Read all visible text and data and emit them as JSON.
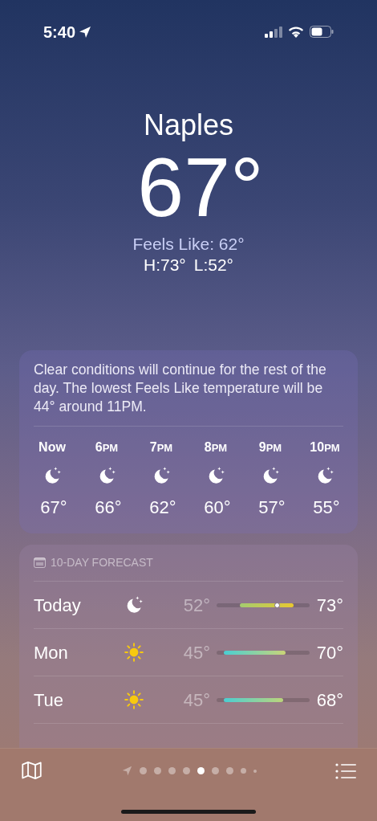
{
  "status_bar": {
    "time": "5:40",
    "location_on": true
  },
  "location": {
    "city": "Naples",
    "temperature": "67°",
    "feels_like": "Feels Like: 62°",
    "high": "H:73°",
    "low": "L:52°"
  },
  "hourly": {
    "summary": "Clear conditions will continue for the rest of the day. The lowest Feels Like temperature will be 44° around 11PM.",
    "hours": [
      {
        "hour": "Now",
        "kind": "moon",
        "temp": "67°"
      },
      {
        "hour": "6",
        "suffix": "PM",
        "kind": "moon",
        "temp": "66°"
      },
      {
        "hour": "7",
        "suffix": "PM",
        "kind": "moon",
        "temp": "62°"
      },
      {
        "hour": "8",
        "suffix": "PM",
        "kind": "moon",
        "temp": "60°"
      },
      {
        "hour": "9",
        "suffix": "PM",
        "kind": "moon",
        "temp": "57°"
      },
      {
        "hour": "10",
        "suffix": "PM",
        "kind": "moon",
        "temp": "55°"
      }
    ]
  },
  "forecast": {
    "title": "10-DAY FORECAST",
    "days": [
      {
        "day": "Today",
        "kind": "moon",
        "low": "52°",
        "high": "73°",
        "start": {
          "level": 0.27,
          "color": "#a6cc6e"
        },
        "end": {
          "level": 0.81,
          "color": "#e6c832"
        },
        "current": {
          "level": 0.65
        }
      },
      {
        "day": "Mon",
        "kind": "sun",
        "low": "45°",
        "high": "70°",
        "start": {
          "level": 0.1,
          "color": "#4fcfcf"
        },
        "end": {
          "level": 0.72,
          "color": "#c6d47a"
        }
      },
      {
        "day": "Tue",
        "kind": "sun",
        "low": "45°",
        "high": "68°",
        "start": {
          "level": 0.1,
          "color": "#4fcfcf"
        },
        "end": {
          "level": 0.69,
          "color": "#b8d47e"
        }
      }
    ]
  },
  "page_dots": [
    {
      "kind": "location",
      "selected": false
    },
    {
      "kind": "dot",
      "selected": false
    },
    {
      "kind": "dot",
      "selected": false
    },
    {
      "kind": "dot",
      "selected": false
    },
    {
      "kind": "dot",
      "selected": false
    },
    {
      "kind": "dot",
      "selected": true
    },
    {
      "kind": "dot",
      "selected": false
    },
    {
      "kind": "dot",
      "selected": false
    },
    {
      "kind": "small",
      "selected": false
    },
    {
      "kind": "tiny",
      "selected": false
    }
  ]
}
